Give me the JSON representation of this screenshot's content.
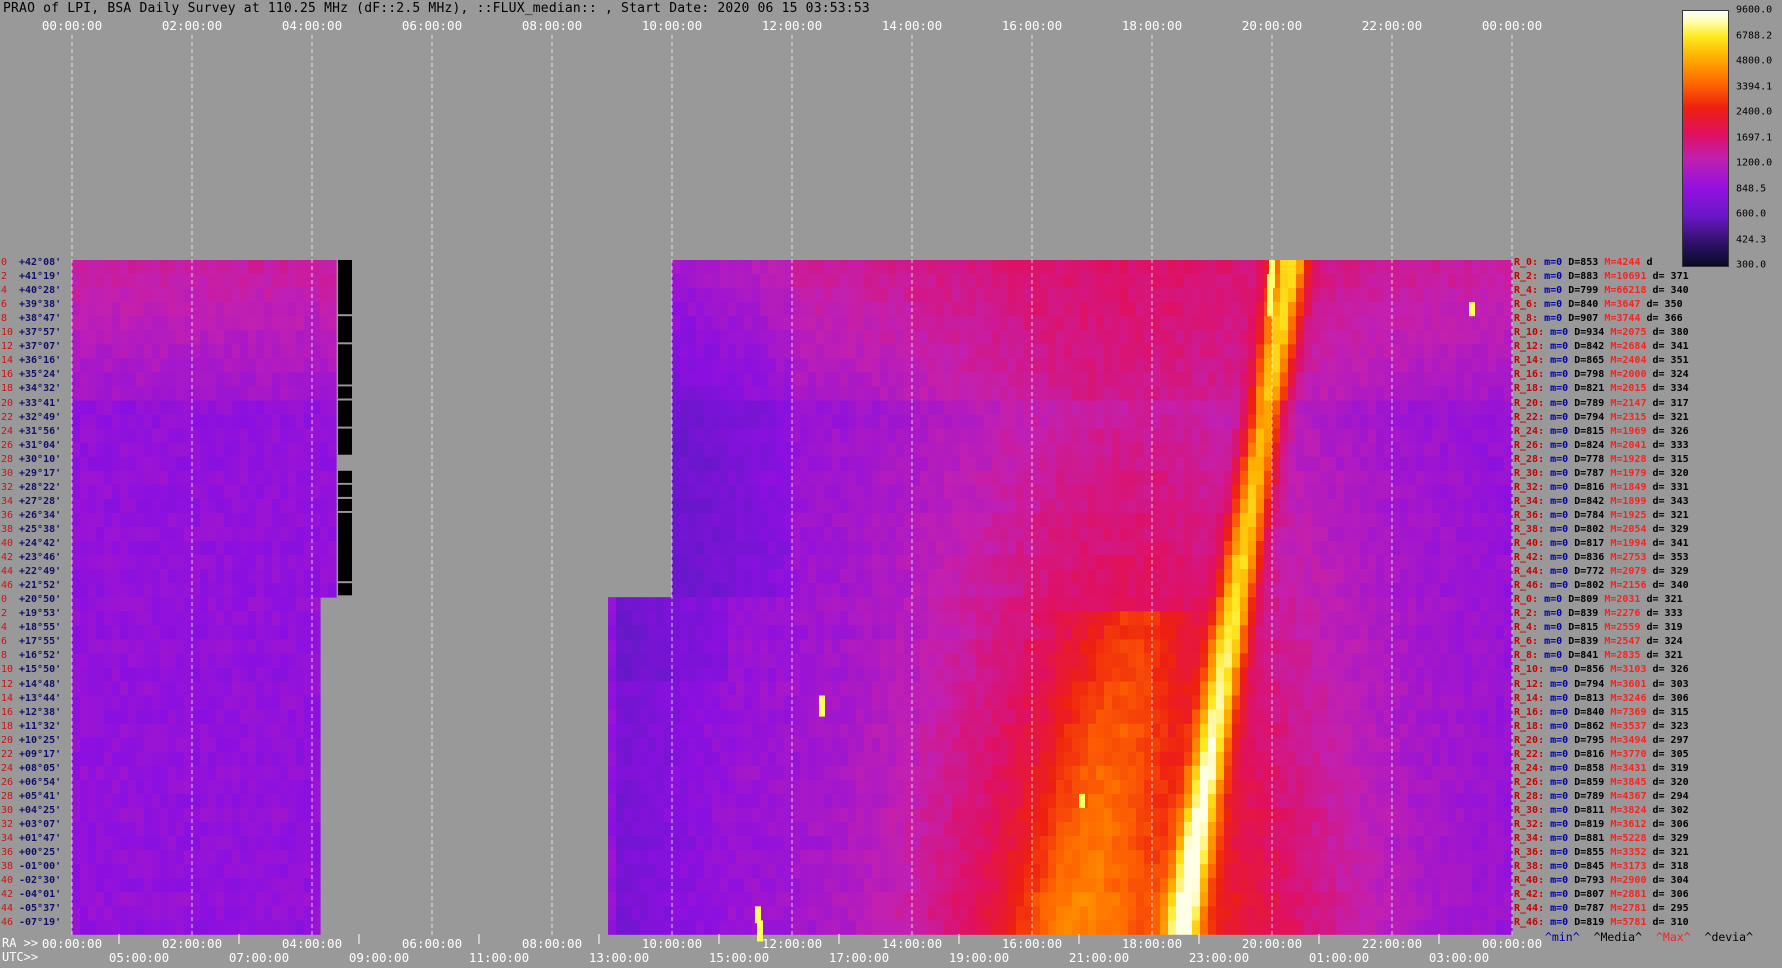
{
  "title": "PRAO of LPI, BSA Daily Survey at 110.25 MHz (dF::2.5 MHz), ::FLUX_median:: , Start Date: 2020 06 15 03:53:53",
  "top_axis_ticks": [
    "00:00:00",
    "02:00:00",
    "04:00:00",
    "06:00:00",
    "08:00:00",
    "10:00:00",
    "12:00:00",
    "14:00:00",
    "16:00:00",
    "18:00:00",
    "20:00:00",
    "22:00:00",
    "00:00:00"
  ],
  "ra_axis": {
    "label": "RA >>",
    "ticks": [
      "00:00:00",
      "02:00:00",
      "04:00:00",
      "06:00:00",
      "08:00:00",
      "10:00:00",
      "12:00:00",
      "14:00:00",
      "16:00:00",
      "18:00:00",
      "20:00:00",
      "22:00:00",
      "00:00:00"
    ]
  },
  "utc_axis": {
    "label": "UTC>>",
    "ticks": [
      "05:00:00",
      "07:00:00",
      "09:00:00",
      "11:00:00",
      "13:00:00",
      "15:00:00",
      "17:00:00",
      "19:00:00",
      "21:00:00",
      "23:00:00",
      "01:00:00",
      "03:00:00"
    ]
  },
  "colorbar": {
    "ticks": [
      "9600.0",
      "6788.2",
      "4800.0",
      "3394.1",
      "2400.0",
      "1697.1",
      "1200.0",
      "848.5",
      "600.0",
      "424.3",
      "300.0"
    ]
  },
  "legend_footer": [
    "^min^",
    "^Media^",
    "^Max^",
    "^devia^"
  ],
  "colors": {
    "background": "#999999",
    "min": "#0000aa",
    "max": "#ff2020",
    "median": "#000000",
    "dev": "#000000",
    "index": "#d01010",
    "declination": "#10106a"
  },
  "chart_data": {
    "type": "heatmap",
    "title": "PRAO of LPI, BSA Daily Survey at 110.25 MHz (dF::2.5 MHz), ::FLUX_median:: , Start Date: 2020 06 15 03:53:53",
    "x_axis": "RA / UTC time",
    "y_axis": "Declination",
    "color_scale": "log",
    "color_range": [
      300.0,
      9600.0
    ],
    "rows": [
      {
        "idx": "0",
        "dec": "+42°08'",
        "key": "R_0:",
        "min": "m=0",
        "median": "D=853",
        "max": "M=4244",
        "dev": "d"
      },
      {
        "idx": "2",
        "dec": "+41°19'",
        "key": "R_2:",
        "min": "m=0",
        "median": "D=883",
        "max": "M=10691",
        "dev": "d= 371"
      },
      {
        "idx": "4",
        "dec": "+40°28'",
        "key": "R_4:",
        "min": "m=0",
        "median": "D=799",
        "max": "M=66218",
        "dev": "d= 340"
      },
      {
        "idx": "6",
        "dec": "+39°38'",
        "key": "R_6:",
        "min": "m=0",
        "median": "D=840",
        "max": "M=3647",
        "dev": "d= 350"
      },
      {
        "idx": "8",
        "dec": "+38°47'",
        "key": "R_8:",
        "min": "m=0",
        "median": "D=907",
        "max": "M=3744",
        "dev": "d= 366"
      },
      {
        "idx": "10",
        "dec": "+37°57'",
        "key": "R_10:",
        "min": "m=0",
        "median": "D=934",
        "max": "M=2075",
        "dev": "d= 380"
      },
      {
        "idx": "12",
        "dec": "+37°07'",
        "key": "R_12:",
        "min": "m=0",
        "median": "D=842",
        "max": "M=2684",
        "dev": "d= 341"
      },
      {
        "idx": "14",
        "dec": "+36°16'",
        "key": "R_14:",
        "min": "m=0",
        "median": "D=865",
        "max": "M=2404",
        "dev": "d= 351"
      },
      {
        "idx": "16",
        "dec": "+35°24'",
        "key": "R_16:",
        "min": "m=0",
        "median": "D=798",
        "max": "M=2000",
        "dev": "d= 324"
      },
      {
        "idx": "18",
        "dec": "+34°32'",
        "key": "R_18:",
        "min": "m=0",
        "median": "D=821",
        "max": "M=2015",
        "dev": "d= 334"
      },
      {
        "idx": "20",
        "dec": "+33°41'",
        "key": "R_20:",
        "min": "m=0",
        "median": "D=789",
        "max": "M=2147",
        "dev": "d= 317"
      },
      {
        "idx": "22",
        "dec": "+32°49'",
        "key": "R_22:",
        "min": "m=0",
        "median": "D=794",
        "max": "M=2315",
        "dev": "d= 321"
      },
      {
        "idx": "24",
        "dec": "+31°56'",
        "key": "R_24:",
        "min": "m=0",
        "median": "D=815",
        "max": "M=1969",
        "dev": "d= 326"
      },
      {
        "idx": "26",
        "dec": "+31°04'",
        "key": "R_26:",
        "min": "m=0",
        "median": "D=824",
        "max": "M=2041",
        "dev": "d= 333"
      },
      {
        "idx": "28",
        "dec": "+30°10'",
        "key": "R_28:",
        "min": "m=0",
        "median": "D=778",
        "max": "M=1928",
        "dev": "d= 315"
      },
      {
        "idx": "30",
        "dec": "+29°17'",
        "key": "R_30:",
        "min": "m=0",
        "median": "D=787",
        "max": "M=1979",
        "dev": "d= 320"
      },
      {
        "idx": "32",
        "dec": "+28°22'",
        "key": "R_32:",
        "min": "m=0",
        "median": "D=816",
        "max": "M=1849",
        "dev": "d= 331"
      },
      {
        "idx": "34",
        "dec": "+27°28'",
        "key": "R_34:",
        "min": "m=0",
        "median": "D=842",
        "max": "M=1899",
        "dev": "d= 343"
      },
      {
        "idx": "36",
        "dec": "+26°34'",
        "key": "R_36:",
        "min": "m=0",
        "median": "D=784",
        "max": "M=1925",
        "dev": "d= 321"
      },
      {
        "idx": "38",
        "dec": "+25°38'",
        "key": "R_38:",
        "min": "m=0",
        "median": "D=802",
        "max": "M=2054",
        "dev": "d= 329"
      },
      {
        "idx": "40",
        "dec": "+24°42'",
        "key": "R_40:",
        "min": "m=0",
        "median": "D=817",
        "max": "M=1994",
        "dev": "d= 341"
      },
      {
        "idx": "42",
        "dec": "+23°46'",
        "key": "R_42:",
        "min": "m=0",
        "median": "D=836",
        "max": "M=2753",
        "dev": "d= 353"
      },
      {
        "idx": "44",
        "dec": "+22°49'",
        "key": "R_44:",
        "min": "m=0",
        "median": "D=772",
        "max": "M=2079",
        "dev": "d= 329"
      },
      {
        "idx": "46",
        "dec": "+21°52'",
        "key": "R_46:",
        "min": "m=0",
        "median": "D=802",
        "max": "M=2156",
        "dev": "d= 340"
      },
      {
        "idx": "0",
        "dec": "+20°50'",
        "key": "R_0:",
        "min": "m=0",
        "median": "D=809",
        "max": "M=2031",
        "dev": "d= 321"
      },
      {
        "idx": "2",
        "dec": "+19°53'",
        "key": "R_2:",
        "min": "m=0",
        "median": "D=839",
        "max": "M=2276",
        "dev": "d= 333"
      },
      {
        "idx": "4",
        "dec": "+18°55'",
        "key": "R_4:",
        "min": "m=0",
        "median": "D=815",
        "max": "M=2559",
        "dev": "d= 319"
      },
      {
        "idx": "6",
        "dec": "+17°55'",
        "key": "R_6:",
        "min": "m=0",
        "median": "D=839",
        "max": "M=2547",
        "dev": "d= 324"
      },
      {
        "idx": "8",
        "dec": "+16°52'",
        "key": "R_8:",
        "min": "m=0",
        "median": "D=841",
        "max": "M=2835",
        "dev": "d= 321"
      },
      {
        "idx": "10",
        "dec": "+15°50'",
        "key": "R_10:",
        "min": "m=0",
        "median": "D=856",
        "max": "M=3103",
        "dev": "d= 326"
      },
      {
        "idx": "12",
        "dec": "+14°48'",
        "key": "R_12:",
        "min": "m=0",
        "median": "D=794",
        "max": "M=3601",
        "dev": "d= 303"
      },
      {
        "idx": "14",
        "dec": "+13°44'",
        "key": "R_14:",
        "min": "m=0",
        "median": "D=813",
        "max": "M=3246",
        "dev": "d= 306"
      },
      {
        "idx": "16",
        "dec": "+12°38'",
        "key": "R_16:",
        "min": "m=0",
        "median": "D=840",
        "max": "M=7369",
        "dev": "d= 315"
      },
      {
        "idx": "18",
        "dec": "+11°32'",
        "key": "R_18:",
        "min": "m=0",
        "median": "D=862",
        "max": "M=3537",
        "dev": "d= 323"
      },
      {
        "idx": "20",
        "dec": "+10°25'",
        "key": "R_20:",
        "min": "m=0",
        "median": "D=795",
        "max": "M=3494",
        "dev": "d= 297"
      },
      {
        "idx": "22",
        "dec": "+09°17'",
        "key": "R_22:",
        "min": "m=0",
        "median": "D=816",
        "max": "M=3770",
        "dev": "d= 305"
      },
      {
        "idx": "24",
        "dec": "+08°05'",
        "key": "R_24:",
        "min": "m=0",
        "median": "D=858",
        "max": "M=3431",
        "dev": "d= 319"
      },
      {
        "idx": "26",
        "dec": "+06°54'",
        "key": "R_26:",
        "min": "m=0",
        "median": "D=859",
        "max": "M=3845",
        "dev": "d= 320"
      },
      {
        "idx": "28",
        "dec": "+05°41'",
        "key": "R_28:",
        "min": "m=0",
        "median": "D=789",
        "max": "M=4367",
        "dev": "d= 294"
      },
      {
        "idx": "30",
        "dec": "+04°25'",
        "key": "R_30:",
        "min": "m=0",
        "median": "D=811",
        "max": "M=3824",
        "dev": "d= 302"
      },
      {
        "idx": "32",
        "dec": "+03°07'",
        "key": "R_32:",
        "min": "m=0",
        "median": "D=819",
        "max": "M=3612",
        "dev": "d= 306"
      },
      {
        "idx": "34",
        "dec": "+01°47'",
        "key": "R_34:",
        "min": "m=0",
        "median": "D=881",
        "max": "M=5228",
        "dev": "d= 329"
      },
      {
        "idx": "36",
        "dec": "+00°25'",
        "key": "R_36:",
        "min": "m=0",
        "median": "D=855",
        "max": "M=3352",
        "dev": "d= 321"
      },
      {
        "idx": "38",
        "dec": "-01°00'",
        "key": "R_38:",
        "min": "m=0",
        "median": "D=845",
        "max": "M=3173",
        "dev": "d= 318"
      },
      {
        "idx": "40",
        "dec": "-02°30'",
        "key": "R_40:",
        "min": "m=0",
        "median": "D=793",
        "max": "M=2900",
        "dev": "d= 304"
      },
      {
        "idx": "42",
        "dec": "-04°01'",
        "key": "R_42:",
        "min": "m=0",
        "median": "D=807",
        "max": "M=2881",
        "dev": "d= 306"
      },
      {
        "idx": "44",
        "dec": "-05°37'",
        "key": "R_44:",
        "min": "m=0",
        "median": "D=787",
        "max": "M=2781",
        "dev": "d= 295"
      },
      {
        "idx": "46",
        "dec": "-07°19'",
        "key": "R_46:",
        "min": "m=0",
        "median": "D=819",
        "max": "M=5781",
        "dev": "d= 310"
      }
    ]
  }
}
